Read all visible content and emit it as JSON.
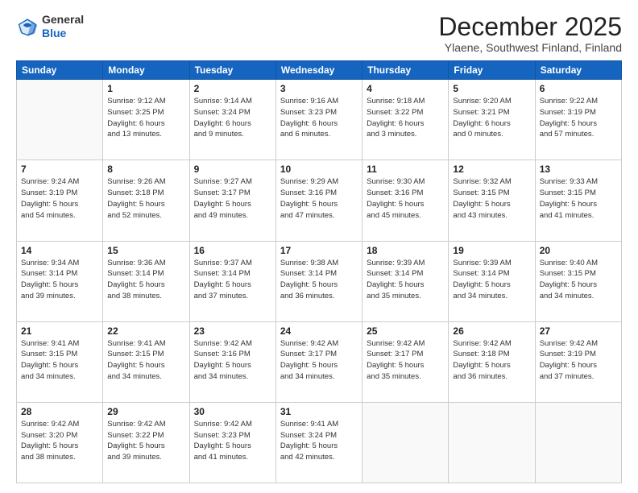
{
  "header": {
    "logo_line1": "General",
    "logo_line2": "Blue",
    "month": "December 2025",
    "location": "Ylaene, Southwest Finland, Finland"
  },
  "weekdays": [
    "Sunday",
    "Monday",
    "Tuesday",
    "Wednesday",
    "Thursday",
    "Friday",
    "Saturday"
  ],
  "weeks": [
    [
      {
        "day": "",
        "info": ""
      },
      {
        "day": "1",
        "info": "Sunrise: 9:12 AM\nSunset: 3:25 PM\nDaylight: 6 hours\nand 13 minutes."
      },
      {
        "day": "2",
        "info": "Sunrise: 9:14 AM\nSunset: 3:24 PM\nDaylight: 6 hours\nand 9 minutes."
      },
      {
        "day": "3",
        "info": "Sunrise: 9:16 AM\nSunset: 3:23 PM\nDaylight: 6 hours\nand 6 minutes."
      },
      {
        "day": "4",
        "info": "Sunrise: 9:18 AM\nSunset: 3:22 PM\nDaylight: 6 hours\nand 3 minutes."
      },
      {
        "day": "5",
        "info": "Sunrise: 9:20 AM\nSunset: 3:21 PM\nDaylight: 6 hours\nand 0 minutes."
      },
      {
        "day": "6",
        "info": "Sunrise: 9:22 AM\nSunset: 3:19 PM\nDaylight: 5 hours\nand 57 minutes."
      }
    ],
    [
      {
        "day": "7",
        "info": "Sunrise: 9:24 AM\nSunset: 3:19 PM\nDaylight: 5 hours\nand 54 minutes."
      },
      {
        "day": "8",
        "info": "Sunrise: 9:26 AM\nSunset: 3:18 PM\nDaylight: 5 hours\nand 52 minutes."
      },
      {
        "day": "9",
        "info": "Sunrise: 9:27 AM\nSunset: 3:17 PM\nDaylight: 5 hours\nand 49 minutes."
      },
      {
        "day": "10",
        "info": "Sunrise: 9:29 AM\nSunset: 3:16 PM\nDaylight: 5 hours\nand 47 minutes."
      },
      {
        "day": "11",
        "info": "Sunrise: 9:30 AM\nSunset: 3:16 PM\nDaylight: 5 hours\nand 45 minutes."
      },
      {
        "day": "12",
        "info": "Sunrise: 9:32 AM\nSunset: 3:15 PM\nDaylight: 5 hours\nand 43 minutes."
      },
      {
        "day": "13",
        "info": "Sunrise: 9:33 AM\nSunset: 3:15 PM\nDaylight: 5 hours\nand 41 minutes."
      }
    ],
    [
      {
        "day": "14",
        "info": "Sunrise: 9:34 AM\nSunset: 3:14 PM\nDaylight: 5 hours\nand 39 minutes."
      },
      {
        "day": "15",
        "info": "Sunrise: 9:36 AM\nSunset: 3:14 PM\nDaylight: 5 hours\nand 38 minutes."
      },
      {
        "day": "16",
        "info": "Sunrise: 9:37 AM\nSunset: 3:14 PM\nDaylight: 5 hours\nand 37 minutes."
      },
      {
        "day": "17",
        "info": "Sunrise: 9:38 AM\nSunset: 3:14 PM\nDaylight: 5 hours\nand 36 minutes."
      },
      {
        "day": "18",
        "info": "Sunrise: 9:39 AM\nSunset: 3:14 PM\nDaylight: 5 hours\nand 35 minutes."
      },
      {
        "day": "19",
        "info": "Sunrise: 9:39 AM\nSunset: 3:14 PM\nDaylight: 5 hours\nand 34 minutes."
      },
      {
        "day": "20",
        "info": "Sunrise: 9:40 AM\nSunset: 3:15 PM\nDaylight: 5 hours\nand 34 minutes."
      }
    ],
    [
      {
        "day": "21",
        "info": "Sunrise: 9:41 AM\nSunset: 3:15 PM\nDaylight: 5 hours\nand 34 minutes."
      },
      {
        "day": "22",
        "info": "Sunrise: 9:41 AM\nSunset: 3:15 PM\nDaylight: 5 hours\nand 34 minutes."
      },
      {
        "day": "23",
        "info": "Sunrise: 9:42 AM\nSunset: 3:16 PM\nDaylight: 5 hours\nand 34 minutes."
      },
      {
        "day": "24",
        "info": "Sunrise: 9:42 AM\nSunset: 3:17 PM\nDaylight: 5 hours\nand 34 minutes."
      },
      {
        "day": "25",
        "info": "Sunrise: 9:42 AM\nSunset: 3:17 PM\nDaylight: 5 hours\nand 35 minutes."
      },
      {
        "day": "26",
        "info": "Sunrise: 9:42 AM\nSunset: 3:18 PM\nDaylight: 5 hours\nand 36 minutes."
      },
      {
        "day": "27",
        "info": "Sunrise: 9:42 AM\nSunset: 3:19 PM\nDaylight: 5 hours\nand 37 minutes."
      }
    ],
    [
      {
        "day": "28",
        "info": "Sunrise: 9:42 AM\nSunset: 3:20 PM\nDaylight: 5 hours\nand 38 minutes."
      },
      {
        "day": "29",
        "info": "Sunrise: 9:42 AM\nSunset: 3:22 PM\nDaylight: 5 hours\nand 39 minutes."
      },
      {
        "day": "30",
        "info": "Sunrise: 9:42 AM\nSunset: 3:23 PM\nDaylight: 5 hours\nand 41 minutes."
      },
      {
        "day": "31",
        "info": "Sunrise: 9:41 AM\nSunset: 3:24 PM\nDaylight: 5 hours\nand 42 minutes."
      },
      {
        "day": "",
        "info": ""
      },
      {
        "day": "",
        "info": ""
      },
      {
        "day": "",
        "info": ""
      }
    ]
  ]
}
